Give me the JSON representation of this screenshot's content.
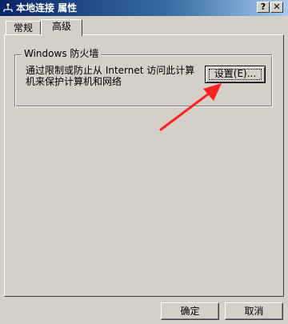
{
  "window": {
    "title": "本地连接 属性",
    "help_button": "?",
    "close_button": "✕"
  },
  "tabs": [
    {
      "label": "常规"
    },
    {
      "label": "高级"
    }
  ],
  "firewall": {
    "group_title": "Windows 防火墙",
    "description": "通过限制或防止从 Internet 访问此计算机来保护计算机和网络",
    "settings_button": "设置(E)..."
  },
  "footer": {
    "ok_label": "确定",
    "cancel_label": "取消"
  },
  "colors": {
    "annotation_arrow": "#ff2020",
    "titlebar_start": "#0a246a",
    "titlebar_end": "#a6caf0",
    "dialog_face": "#d4d0c8"
  },
  "icons": {
    "app": "network-connection-icon",
    "annotation": "red-arrow-icon"
  }
}
